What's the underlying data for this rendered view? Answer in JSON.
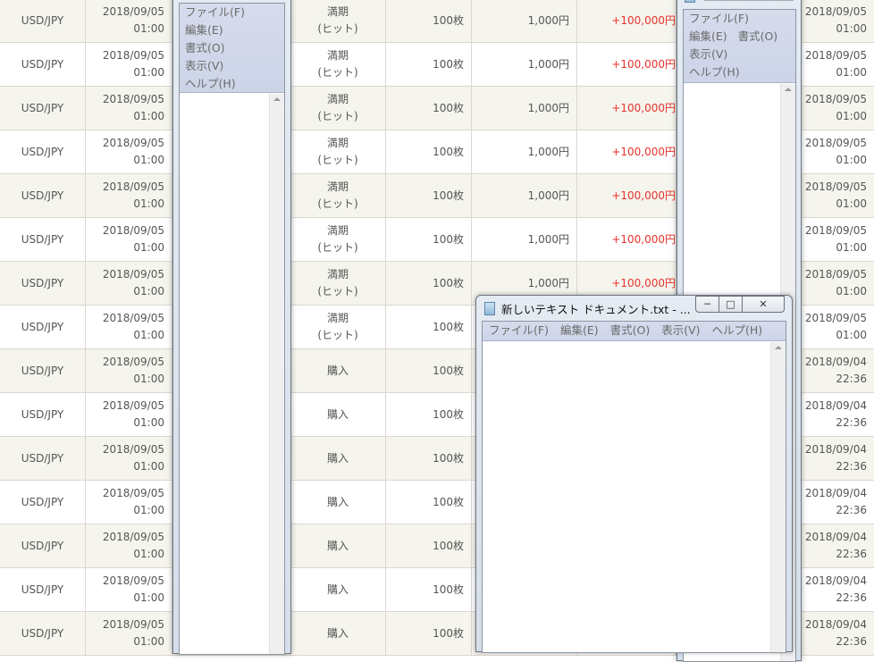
{
  "table": {
    "rows": [
      {
        "pair": "USD/JPY",
        "date": "2018/09/05",
        "time": "01:00",
        "type": [
          "満期",
          "(ヒット)"
        ],
        "qty": "100枚",
        "price": "1,000円",
        "pl": "+100,000円",
        "date2": "2018/09/05",
        "time2": "01:00"
      },
      {
        "pair": "USD/JPY",
        "date": "2018/09/05",
        "time": "01:00",
        "type": [
          "満期",
          "(ヒット)"
        ],
        "qty": "100枚",
        "price": "1,000円",
        "pl": "+100,000円",
        "date2": "2018/09/05",
        "time2": "01:00"
      },
      {
        "pair": "USD/JPY",
        "date": "2018/09/05",
        "time": "01:00",
        "type": [
          "満期",
          "(ヒット)"
        ],
        "qty": "100枚",
        "price": "1,000円",
        "pl": "+100,000円",
        "date2": "2018/09/05",
        "time2": "01:00"
      },
      {
        "pair": "USD/JPY",
        "date": "2018/09/05",
        "time": "01:00",
        "type": [
          "満期",
          "(ヒット)"
        ],
        "qty": "100枚",
        "price": "1,000円",
        "pl": "+100,000円",
        "date2": "2018/09/05",
        "time2": "01:00"
      },
      {
        "pair": "USD/JPY",
        "date": "2018/09/05",
        "time": "01:00",
        "type": [
          "満期",
          "(ヒット)"
        ],
        "qty": "100枚",
        "price": "1,000円",
        "pl": "+100,000円",
        "date2": "2018/09/05",
        "time2": "01:00"
      },
      {
        "pair": "USD/JPY",
        "date": "2018/09/05",
        "time": "01:00",
        "type": [
          "満期",
          "(ヒット)"
        ],
        "qty": "100枚",
        "price": "1,000円",
        "pl": "+100,000円",
        "date2": "2018/09/05",
        "time2": "01:00"
      },
      {
        "pair": "USD/JPY",
        "date": "2018/09/05",
        "time": "01:00",
        "type": [
          "満期",
          "(ヒット)"
        ],
        "qty": "100枚",
        "price": "1,000円",
        "pl": "+100,000円",
        "date2": "2018/09/05",
        "time2": "01:00"
      },
      {
        "pair": "USD/JPY",
        "date": "2018/09/05",
        "time": "01:00",
        "type": [
          "満期",
          "(ヒット)"
        ],
        "qty": "100枚",
        "price": "",
        "pl": "",
        "date2": "2018/09/05",
        "time2": "01:00"
      },
      {
        "pair": "USD/JPY",
        "date": "2018/09/05",
        "time": "01:00",
        "type": [
          "購入"
        ],
        "qty": "100枚",
        "price": "",
        "pl": "",
        "date2": "2018/09/04",
        "time2": "22:36"
      },
      {
        "pair": "USD/JPY",
        "date": "2018/09/05",
        "time": "01:00",
        "type": [
          "購入"
        ],
        "qty": "100枚",
        "price": "",
        "pl": "",
        "date2": "2018/09/04",
        "time2": "22:36"
      },
      {
        "pair": "USD/JPY",
        "date": "2018/09/05",
        "time": "01:00",
        "type": [
          "購入"
        ],
        "qty": "100枚",
        "price": "",
        "pl": "",
        "date2": "2018/09/04",
        "time2": "22:36"
      },
      {
        "pair": "USD/JPY",
        "date": "2018/09/05",
        "time": "01:00",
        "type": [
          "購入"
        ],
        "qty": "100枚",
        "price": "",
        "pl": "",
        "date2": "2018/09/04",
        "time2": "22:36"
      },
      {
        "pair": "USD/JPY",
        "date": "2018/09/05",
        "time": "01:00",
        "type": [
          "購入"
        ],
        "qty": "100枚",
        "price": "",
        "pl": "",
        "date2": "2018/09/04",
        "time2": "22:36"
      },
      {
        "pair": "USD/JPY",
        "date": "2018/09/05",
        "time": "01:00",
        "type": [
          "購入"
        ],
        "qty": "100枚",
        "price": "",
        "pl": "",
        "date2": "2018/09/04",
        "time2": "22:36"
      },
      {
        "pair": "USD/JPY",
        "date": "2018/09/05",
        "time": "01:00",
        "type": [
          "購入"
        ],
        "qty": "100枚",
        "price": "",
        "pl": "",
        "date2": "2018/09/04",
        "time2": "22:36"
      }
    ],
    "colors": {
      "row_alt": "#f5f5ee",
      "profit": "#e8322c"
    }
  },
  "notepad_left": {
    "menu": [
      "ファイル(F)",
      "編集(E)",
      "書式(O)",
      "表示(V)",
      "ヘルプ(H)"
    ]
  },
  "notepad_right": {
    "menu": [
      "ファイル(F)",
      "編集(E)",
      "書式(O)",
      "表示(V)",
      "ヘルプ(H)"
    ]
  },
  "notepad_main": {
    "title": "新しいテキスト ドキュメント.txt - ...",
    "menu": [
      "ファイル(F)",
      "編集(E)",
      "書式(O)",
      "表示(V)",
      "ヘルプ(H)"
    ],
    "minimize": "─",
    "maximize": "□",
    "close": "✕"
  }
}
